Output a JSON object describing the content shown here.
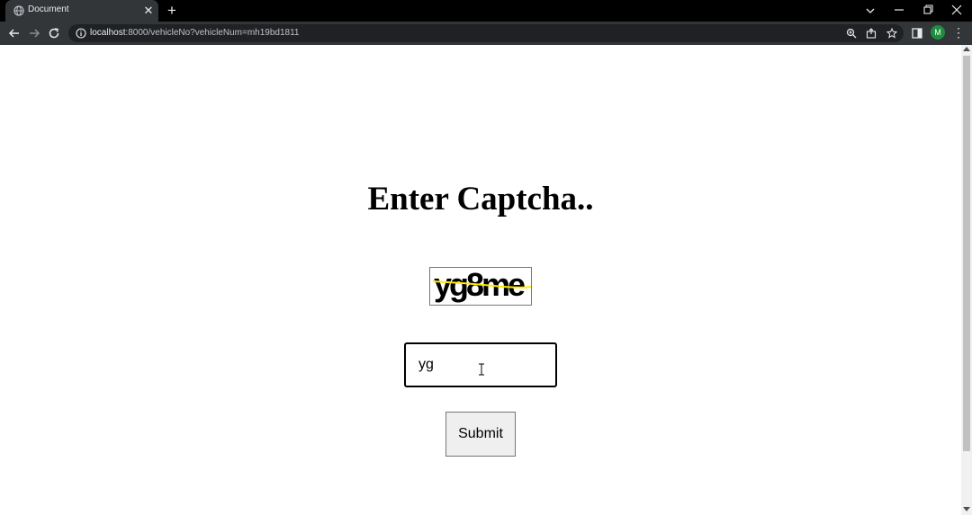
{
  "browser": {
    "tab": {
      "title": "Document"
    },
    "url": {
      "host": "localhost",
      "rest": ":8000/vehicleNo?vehicleNum=mh19bd1811"
    },
    "profile_initial": "M",
    "icons": [
      "globe-icon",
      "close-icon",
      "plus-icon",
      "back-icon",
      "forward-icon",
      "reload-icon",
      "info-icon",
      "zoom-icon",
      "share-icon",
      "star-icon",
      "sidebar-icon",
      "kebab-icon"
    ]
  },
  "page": {
    "heading": "Enter Captcha..",
    "captcha_text": "yg8me",
    "answer_value": "yg",
    "submit_label": "Submit"
  },
  "colors": {
    "chrome_dark": "#323639",
    "tabbar": "#000000",
    "avatar": "#1e8e3e",
    "captcha_line": "#ffeb00"
  }
}
